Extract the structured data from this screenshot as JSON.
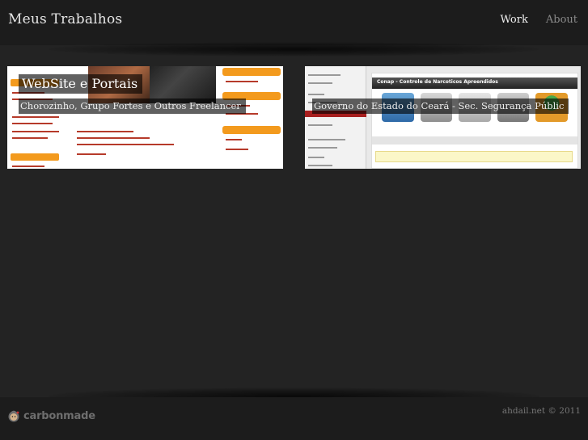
{
  "header": {
    "site_title": "Meus Trabalhos",
    "nav": [
      {
        "label": "Work",
        "active": true
      },
      {
        "label": "About",
        "active": false
      }
    ]
  },
  "projects": [
    {
      "title": "WebSite e Portais",
      "subtitle": "Chorozinho, Grupo Fortes e Outros Freelancer"
    },
    {
      "title": "",
      "subtitle": "Governo do Estado do Ceará - Sec. Segurança Públic",
      "thumb_header": "Conap - Controle de Narcoticos Apreendidos"
    }
  ],
  "footer": {
    "brand": "carbonmade",
    "copyright": "ahdail.net © 2011"
  },
  "colors": {
    "background": "#232323",
    "header_bg": "#1c1c1c",
    "orange_accent": "#f39a1d",
    "conap_red": "#a81f1f"
  }
}
